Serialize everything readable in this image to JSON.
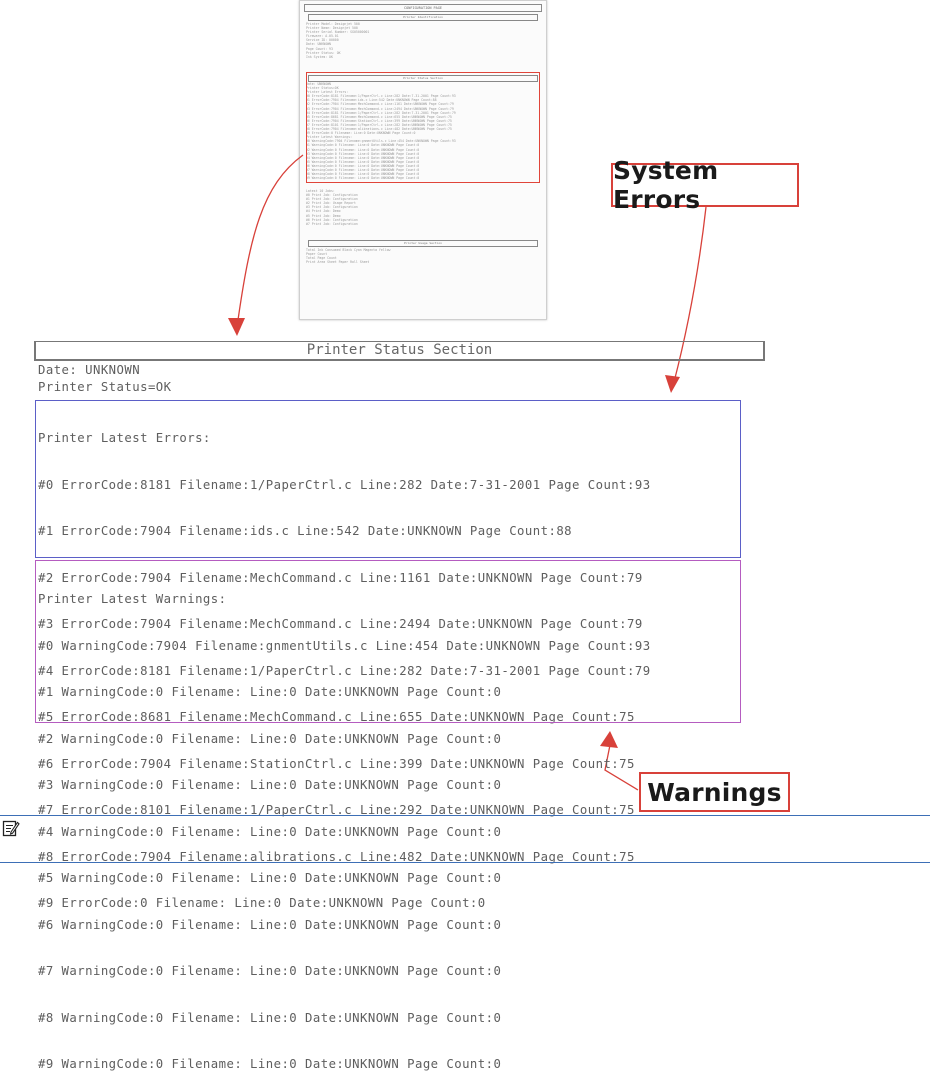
{
  "thumbnail": {
    "title": "CONFIGURATION PAGE",
    "header1": "Printer Identification",
    "ident_lines": [
      "Printer Model: Designjet 500",
      "Printer Name: Designjet 500",
      "Printer Serial Number: SG05000001",
      "Firmware: A.05.01",
      "Service ID: 00000",
      "Date: UNKNOWN",
      "Page Count: 93",
      "Printer Status: OK",
      "Ink System: OK"
    ],
    "header2": "Printer Status Section",
    "status_lines": [
      "Date: UNKNOWN",
      "Printer Status=OK",
      "Printer Latest Errors:",
      "#0 ErrorCode:8181 Filename:1/PaperCtrl.c Line:282 Date:7-31-2001 Page Count:93",
      "#1 ErrorCode:7904 Filename:ids.c Line:542 Date:UNKNOWN Page Count:88",
      "#2 ErrorCode:7904 Filename:MechCommand.c Line:1161 Date:UNKNOWN Page Count:79",
      "#3 ErrorCode:7904 Filename:MechCommand.c Line:2494 Date:UNKNOWN Page Count:79",
      "#4 ErrorCode:8181 Filename:1/PaperCtrl.c Line:282 Date:7-31-2001 Page Count:79",
      "#5 ErrorCode:8681 Filename:MechCommand.c Line:655 Date:UNKNOWN Page Count:75",
      "#6 ErrorCode:7904 Filename:StationCtrl.c Line:399 Date:UNKNOWN Page Count:75",
      "#7 ErrorCode:8101 Filename:1/PaperCtrl.c Line:282 Date:UNKNOWN Page Count:75",
      "#8 ErrorCode:7904 Filename:alibrations.c Line:482 Date:UNKNOWN Page Count:75",
      "#9 ErrorCode:0 Filename: Line:0 Date:UNKNOWN Page Count:0",
      "Printer Latest Warnings:",
      "#0 WarningCode:7904 Filename:gnmentUtils.c Line:454 Date:UNKNOWN Page Count:93",
      "#1 WarningCode:0 Filename: Line:0 Date:UNKNOWN Page Count:0",
      "#2 WarningCode:0 Filename: Line:0 Date:UNKNOWN Page Count:0",
      "#3 WarningCode:0 Filename: Line:0 Date:UNKNOWN Page Count:0",
      "#4 WarningCode:0 Filename: Line:0 Date:UNKNOWN Page Count:0",
      "#5 WarningCode:0 Filename: Line:0 Date:UNKNOWN Page Count:0",
      "#6 WarningCode:0 Filename: Line:0 Date:UNKNOWN Page Count:0",
      "#7 WarningCode:0 Filename: Line:0 Date:UNKNOWN Page Count:0",
      "#8 WarningCode:0 Filename: Line:0 Date:UNKNOWN Page Count:0",
      "#9 WarningCode:0 Filename: Line:0 Date:UNKNOWN Page Count:0"
    ],
    "latest_lines": [
      "Latest 10 Jobs:",
      "#0 Print Job: Configuration",
      "#1 Print Job: Configuration",
      "#2 Print Job: Usage Report",
      "#3 Print Job: Configuration",
      "#4 Print Job: Demo",
      "#5 Print Job: Demo",
      "#6 Print Job: Configuration",
      "#7 Print Job: Configuration"
    ],
    "header3": "Printer Usage Section",
    "usage_lines": [
      "Total Ink Consumed  Black  Cyan  Magenta  Yellow",
      "Paper Count",
      "Total Page Count",
      "Print Area Sheet    Paper Roll  Sheet"
    ]
  },
  "callouts": {
    "system_errors": "System Errors",
    "warnings": "Warnings"
  },
  "status_section": {
    "title": "Printer Status Section",
    "date_line": "Date: UNKNOWN",
    "status_line": "Printer Status=OK",
    "errors_header": "Printer Latest Errors:",
    "errors": [
      "#0 ErrorCode:8181 Filename:1/PaperCtrl.c Line:282 Date:7-31-2001 Page Count:93",
      "#1 ErrorCode:7904 Filename:ids.c Line:542 Date:UNKNOWN Page Count:88",
      "#2 ErrorCode:7904 Filename:MechCommand.c Line:1161 Date:UNKNOWN Page Count:79",
      "#3 ErrorCode:7904 Filename:MechCommand.c Line:2494 Date:UNKNOWN Page Count:79",
      "#4 ErrorCode:8181 Filename:1/PaperCtrl.c Line:282 Date:7-31-2001 Page Count:79",
      "#5 ErrorCode:8681 Filename:MechCommand.c Line:655 Date:UNKNOWN Page Count:75",
      "#6 ErrorCode:7904 Filename:StationCtrl.c Line:399 Date:UNKNOWN Page Count:75",
      "#7 ErrorCode:8101 Filename:1/PaperCtrl.c Line:292 Date:UNKNOWN Page Count:75",
      "#8 ErrorCode:7904 Filename:alibrations.c Line:482 Date:UNKNOWN Page Count:75",
      "#9 ErrorCode:0 Filename: Line:0 Date:UNKNOWN Page Count:0"
    ],
    "warnings_header": "Printer Latest Warnings:",
    "warnings": [
      "#0 WarningCode:7904 Filename:gnmentUtils.c Line:454 Date:UNKNOWN Page Count:93",
      "#1 WarningCode:0 Filename: Line:0 Date:UNKNOWN Page Count:0",
      "#2 WarningCode:0 Filename: Line:0 Date:UNKNOWN Page Count:0",
      "#3 WarningCode:0 Filename: Line:0 Date:UNKNOWN Page Count:0",
      "#4 WarningCode:0 Filename: Line:0 Date:UNKNOWN Page Count:0",
      "#5 WarningCode:0 Filename: Line:0 Date:UNKNOWN Page Count:0",
      "#6 WarningCode:0 Filename: Line:0 Date:UNKNOWN Page Count:0",
      "#7 WarningCode:0 Filename: Line:0 Date:UNKNOWN Page Count:0",
      "#8 WarningCode:0 Filename: Line:0 Date:UNKNOWN Page Count:0",
      "#9 WarningCode:0 Filename: Line:0 Date:UNKNOWN Page Count:0"
    ]
  },
  "note": {
    "icon": "note-icon"
  },
  "colors": {
    "highlight_red": "#d8413a",
    "errors_border": "#5b5fc7",
    "warnings_border": "#b55cc0",
    "rule_blue": "#3d6fb6"
  }
}
